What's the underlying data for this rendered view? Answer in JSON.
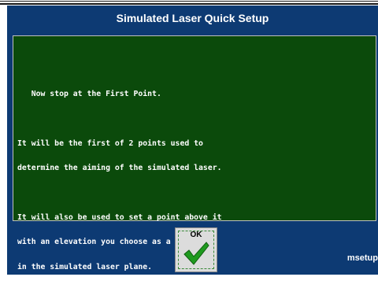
{
  "window": {
    "title": "Simulated Laser Quick Setup",
    "footer_id": "msetup"
  },
  "message": {
    "lead": "   Now stop at the First Point.",
    "para1": [
      "It will be the first of 2 points used to",
      "determine the aiming of the simulated laser."
    ],
    "para2": [
      "It will also be used to set a point above it",
      "with an elevation you choose as a point",
      "in the simulated laser plane."
    ]
  },
  "ok_button": {
    "label": "OK",
    "icon": "checkmark-icon"
  },
  "colors": {
    "window_bg": "#0d3a73",
    "panel_bg": "#0b4a0b",
    "check_green": "#1f9a1f"
  }
}
